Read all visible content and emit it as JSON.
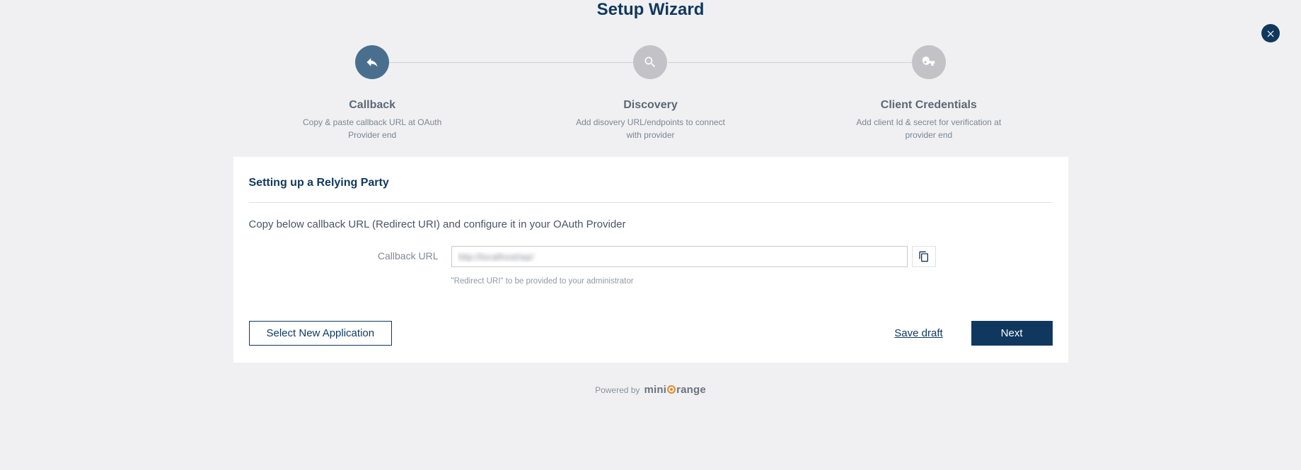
{
  "title": "Setup Wizard",
  "steps": [
    {
      "title": "Callback",
      "desc": "Copy & paste callback URL at OAuth Provider end"
    },
    {
      "title": "Discovery",
      "desc": "Add disovery URL/endpoints to connect with provider"
    },
    {
      "title": "Client Credentials",
      "desc": "Add client Id & secret for verification at provider end"
    }
  ],
  "panel": {
    "heading": "Setting up a Relying Party",
    "instruction": "Copy below callback URL (Redirect URI) and configure it in your OAuth Provider",
    "field_label": "Callback URL",
    "field_value": "http://localhost/wp/",
    "field_help": "\"Redirect URI\" to be provided to your administrator"
  },
  "actions": {
    "select_app": "Select New Application",
    "save_draft": "Save draft",
    "next": "Next"
  },
  "footer": {
    "powered_by": "Powered by",
    "brand_prefix": "mini",
    "brand_suffix": "range"
  }
}
